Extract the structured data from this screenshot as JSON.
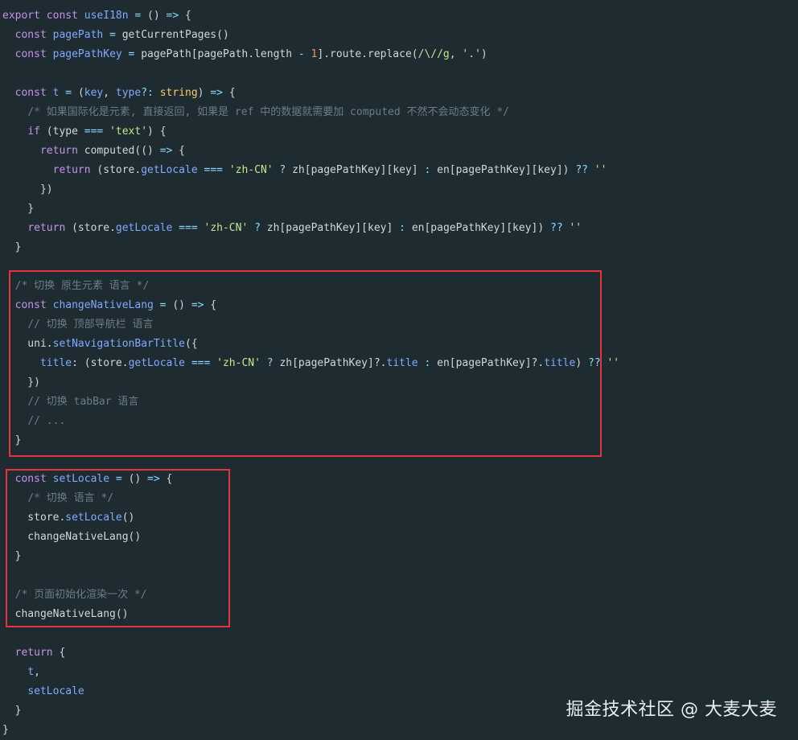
{
  "colors": {
    "background": "#1e2b31",
    "keyword": "#c792ea",
    "function": "#82aaff",
    "string": "#c3e88d",
    "operator": "#89ddff",
    "number": "#f78c6c",
    "comment": "#6b7d86",
    "type": "#ffcb6b",
    "plain": "#d1d7da",
    "highlight_border": "#e8333f"
  },
  "code": {
    "lines": [
      [
        [
          "kw",
          "export "
        ],
        [
          "kw",
          "const "
        ],
        [
          "fn",
          "useI18n"
        ],
        [
          "op",
          " = "
        ],
        [
          "plain",
          "() "
        ],
        [
          "op",
          "=> "
        ],
        [
          "plain",
          "{"
        ]
      ],
      [
        [
          "plain",
          "  "
        ],
        [
          "kw",
          "const "
        ],
        [
          "fn",
          "pagePath"
        ],
        [
          "op",
          " = "
        ],
        [
          "plain",
          "getCurrentPages()"
        ]
      ],
      [
        [
          "plain",
          "  "
        ],
        [
          "kw",
          "const "
        ],
        [
          "fn",
          "pagePathKey"
        ],
        [
          "op",
          " = "
        ],
        [
          "plain",
          "pagePath[pagePath."
        ],
        [
          "plain",
          "length"
        ],
        [
          "op",
          " - "
        ],
        [
          "num",
          "1"
        ],
        [
          "plain",
          "]."
        ],
        [
          "plain",
          "route"
        ],
        [
          "plain",
          "."
        ],
        [
          "plain",
          "replace"
        ],
        [
          "plain",
          "("
        ],
        [
          "str",
          "/\\//g"
        ],
        [
          "plain",
          ", "
        ],
        [
          "str",
          "'.'"
        ],
        [
          "plain",
          ")"
        ]
      ],
      [],
      [
        [
          "plain",
          "  "
        ],
        [
          "kw",
          "const "
        ],
        [
          "fn",
          "t"
        ],
        [
          "op",
          " = "
        ],
        [
          "plain",
          "("
        ],
        [
          "fn",
          "key"
        ],
        [
          "plain",
          ", "
        ],
        [
          "fn",
          "type"
        ],
        [
          "op",
          "?: "
        ],
        [
          "type",
          "string"
        ],
        [
          "plain",
          ") "
        ],
        [
          "op",
          "=> "
        ],
        [
          "plain",
          "{"
        ]
      ],
      [
        [
          "plain",
          "    "
        ],
        [
          "com",
          "/* 如果国际化是元素, 直接返回, 如果是 ref 中的数据就需要加 computed 不然不会动态变化 */"
        ]
      ],
      [
        [
          "plain",
          "    "
        ],
        [
          "kw",
          "if "
        ],
        [
          "plain",
          "(type "
        ],
        [
          "op",
          "=== "
        ],
        [
          "str",
          "'text'"
        ],
        [
          "plain",
          ") {"
        ]
      ],
      [
        [
          "plain",
          "      "
        ],
        [
          "kw",
          "return "
        ],
        [
          "plain",
          "computed(() "
        ],
        [
          "op",
          "=> "
        ],
        [
          "plain",
          "{"
        ]
      ],
      [
        [
          "plain",
          "        "
        ],
        [
          "kw",
          "return "
        ],
        [
          "plain",
          "(store."
        ],
        [
          "fn",
          "getLocale"
        ],
        [
          "op",
          " === "
        ],
        [
          "str",
          "'zh-CN'"
        ],
        [
          "op",
          " ? "
        ],
        [
          "plain",
          "zh[pagePathKey][key] "
        ],
        [
          "op",
          ": "
        ],
        [
          "plain",
          "en[pagePathKey][key]) "
        ],
        [
          "op",
          "?? "
        ],
        [
          "str",
          "''"
        ]
      ],
      [
        [
          "plain",
          "      })"
        ]
      ],
      [
        [
          "plain",
          "    }"
        ]
      ],
      [
        [
          "plain",
          "    "
        ],
        [
          "kw",
          "return "
        ],
        [
          "plain",
          "(store."
        ],
        [
          "fn",
          "getLocale"
        ],
        [
          "op",
          " === "
        ],
        [
          "str",
          "'zh-CN'"
        ],
        [
          "op",
          " ? "
        ],
        [
          "plain",
          "zh[pagePathKey][key] "
        ],
        [
          "op",
          ": "
        ],
        [
          "plain",
          "en[pagePathKey][key]) "
        ],
        [
          "op",
          "?? "
        ],
        [
          "str",
          "''"
        ]
      ],
      [
        [
          "plain",
          "  }"
        ]
      ],
      [],
      [
        [
          "plain",
          "  "
        ],
        [
          "com",
          "/* 切换 原生元素 语言 */"
        ]
      ],
      [
        [
          "plain",
          "  "
        ],
        [
          "kw",
          "const "
        ],
        [
          "fn",
          "changeNativeLang"
        ],
        [
          "op",
          " = "
        ],
        [
          "plain",
          "() "
        ],
        [
          "op",
          "=> "
        ],
        [
          "plain",
          "{"
        ]
      ],
      [
        [
          "plain",
          "    "
        ],
        [
          "com",
          "// 切换 顶部导航栏 语言"
        ]
      ],
      [
        [
          "plain",
          "    uni."
        ],
        [
          "fn",
          "setNavigationBarTitle"
        ],
        [
          "plain",
          "({"
        ]
      ],
      [
        [
          "plain",
          "      "
        ],
        [
          "fn",
          "title"
        ],
        [
          "plain",
          ": (store."
        ],
        [
          "fn",
          "getLocale"
        ],
        [
          "op",
          " === "
        ],
        [
          "str",
          "'zh-CN'"
        ],
        [
          "op",
          " ? "
        ],
        [
          "plain",
          "zh[pagePathKey]?."
        ],
        [
          "fn",
          "title"
        ],
        [
          "op",
          " : "
        ],
        [
          "plain",
          "en[pagePathKey]?."
        ],
        [
          "fn",
          "title"
        ],
        [
          "plain",
          ") "
        ],
        [
          "op",
          "?? "
        ],
        [
          "str",
          "''"
        ]
      ],
      [
        [
          "plain",
          "    })"
        ]
      ],
      [
        [
          "plain",
          "    "
        ],
        [
          "com",
          "// 切换 tabBar 语言"
        ]
      ],
      [
        [
          "plain",
          "    "
        ],
        [
          "com",
          "// ..."
        ]
      ],
      [
        [
          "plain",
          "  }"
        ]
      ],
      [],
      [
        [
          "plain",
          "  "
        ],
        [
          "kw",
          "const "
        ],
        [
          "fn",
          "setLocale"
        ],
        [
          "op",
          " = "
        ],
        [
          "plain",
          "() "
        ],
        [
          "op",
          "=> "
        ],
        [
          "plain",
          "{"
        ]
      ],
      [
        [
          "plain",
          "    "
        ],
        [
          "com",
          "/* 切换 语言 */"
        ]
      ],
      [
        [
          "plain",
          "    store."
        ],
        [
          "fn",
          "setLocale"
        ],
        [
          "plain",
          "()"
        ]
      ],
      [
        [
          "plain",
          "    changeNativeLang()"
        ]
      ],
      [
        [
          "plain",
          "  }"
        ]
      ],
      [],
      [
        [
          "plain",
          "  "
        ],
        [
          "com",
          "/* 页面初始化渲染一次 */"
        ]
      ],
      [
        [
          "plain",
          "  changeNativeLang()"
        ]
      ],
      [],
      [
        [
          "plain",
          "  "
        ],
        [
          "kw",
          "return "
        ],
        [
          "plain",
          "{"
        ]
      ],
      [
        [
          "plain",
          "    "
        ],
        [
          "fn",
          "t"
        ],
        [
          "plain",
          ","
        ]
      ],
      [
        [
          "plain",
          "    "
        ],
        [
          "fn",
          "setLocale"
        ]
      ],
      [
        [
          "plain",
          "  }"
        ]
      ],
      [
        [
          "plain",
          "}"
        ]
      ]
    ]
  },
  "watermark": "掘金技术社区 @ 大麦大麦"
}
